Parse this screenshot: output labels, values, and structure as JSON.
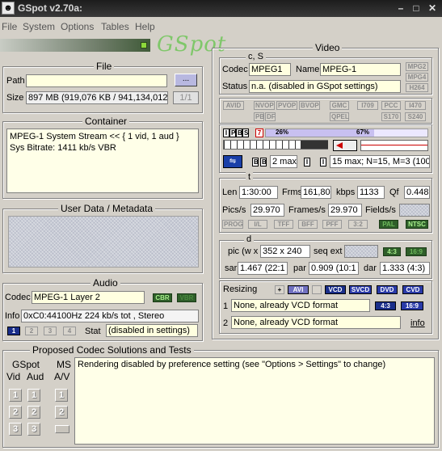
{
  "title": "GSpot v2.70a:",
  "window_controls": [
    "–",
    "□",
    "✕"
  ],
  "menu": [
    "File",
    "System",
    "Options",
    "Tables",
    "Help"
  ],
  "logo_text": "GSpot",
  "file": {
    "legend": "File",
    "path_label": "Path",
    "path_value": "",
    "browse_label": "...",
    "size_label": "Size",
    "size_value": "897 MB (919,076 KB / 941,134,012",
    "size_frac": "1/1"
  },
  "container": {
    "legend": "Container",
    "lines": [
      "MPEG-1 System Stream << { 1 vid, 1 aud }",
      "Sys Bitrate: 1411 kb/s VBR"
    ]
  },
  "userdata": {
    "legend": "User Data / Metadata"
  },
  "audio": {
    "legend": "Audio",
    "codec_label": "Codec",
    "codec_value": "MPEG-1 Layer 2",
    "cbr": "CBR",
    "vbr": "VBR",
    "info_label": "Info",
    "info_value": "0xC0:44100Hz  224 kb/s tot , Stereo",
    "streams": [
      "1",
      "2",
      "3",
      "4"
    ],
    "stat_label": "Stat",
    "stat_value": "(disabled in settings)"
  },
  "video": {
    "legend": "Video",
    "cs_label": "c, S",
    "codec_label": "Codec",
    "codec_value": "MPEG1",
    "name_label": "Name",
    "name_value": "MPEG-1",
    "mpeg_tags": [
      "MPG2",
      "MPG4",
      "H264"
    ],
    "status_label": "Status",
    "status_value": "n.a. (disabled in GSpot settings)",
    "flag_tags_row1": [
      "AVID",
      "NVOP",
      "PVOP",
      "BVOP",
      "GMC",
      "I709",
      "PCC",
      "I470"
    ],
    "flag_tags_row2": [
      "PB",
      "DF",
      "QPEL",
      "S170",
      "S240"
    ],
    "gop_frames": [
      "I",
      "P",
      "B",
      "S"
    ],
    "gop_marker": "7",
    "pct1": "26%",
    "pct1_fill": 0.26,
    "pct2": "67%",
    "pct2_fill": 0.67,
    "bmax": "2 max",
    "gop_value": "15 max; N=15, M=3 (100",
    "t_label": "t",
    "len_label": "Len",
    "len_value": "1:30:00",
    "frms_label": "Frms",
    "frms_value": "161,80",
    "kbps_label": "kbps",
    "kbps_value": "1133",
    "qf_label": "Qf",
    "qf_value": "0.448",
    "pics_label": "Pics/s",
    "pics_value": "29.970",
    "frames_label": "Frames/s",
    "frames_value": "29.970",
    "fields_label": "Fields/s",
    "fields_value": "",
    "scan_tags": [
      "PROG",
      "I/L",
      "TFF",
      "BFF",
      "PFF",
      "3:2"
    ],
    "pal": "PAL",
    "ntsc": "NTSC",
    "d_label": "d",
    "pic_label": "pic (w x",
    "pic_value": "352 x 240",
    "seq_label": "seq ext",
    "seq_value": "",
    "ar1": "4:3",
    "ar2": "16:9",
    "sar_label": "sar",
    "sar_value": "1.467 (22:1",
    "par_label": "par",
    "par_value": "0.909 (10:1",
    "dar_label": "dar",
    "dar_value": "1.333 (4:3)",
    "resizing_label": "Resizing",
    "resize_plus": "+",
    "resize_tags": [
      "AVI",
      "VCD",
      "SVCD",
      "DVD",
      "CVD"
    ],
    "r1_num": "1",
    "r1_value": "None, already VCD format",
    "r2_num": "2",
    "r2_value": "None, already VCD format",
    "r_ar1": "4:3",
    "r_ar2": "16:9",
    "info_link": "info"
  },
  "proposed": {
    "legend": "Proposed Codec Solutions and Tests",
    "gspot_label": "GSpot",
    "vid_label": "Vid",
    "aud_label": "Aud",
    "ms_label": "MS",
    "av_label": "A/V",
    "nums": [
      "1",
      "2",
      "3"
    ],
    "message": "Rendering disabled by preference setting (see \"Options > Settings\" to change)"
  }
}
